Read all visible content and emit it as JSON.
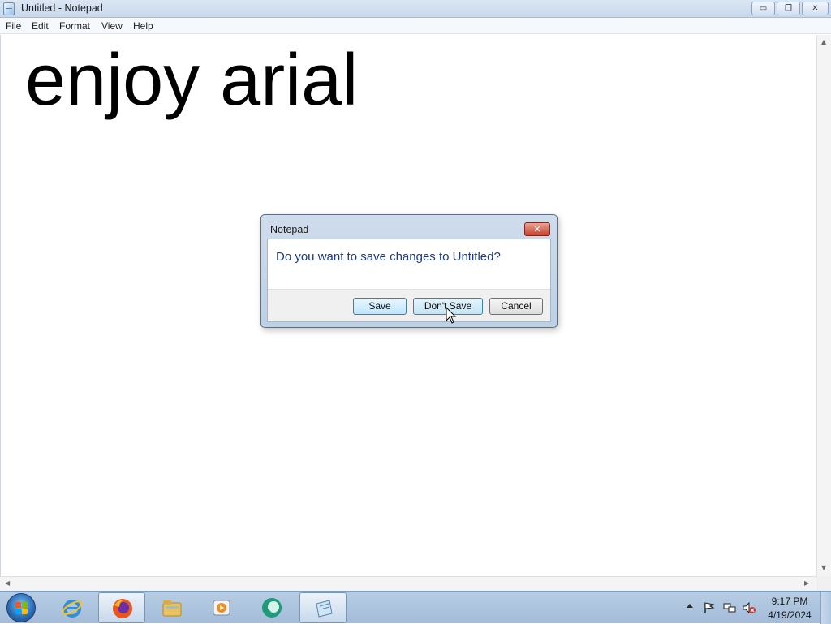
{
  "window": {
    "title": "Untitled - Notepad",
    "controls": {
      "minimize": "▭",
      "maximize": "❐",
      "close": "✕"
    }
  },
  "menu": {
    "items": [
      "File",
      "Edit",
      "Format",
      "View",
      "Help"
    ]
  },
  "editor": {
    "content": "enjoy arial"
  },
  "dialog": {
    "title": "Notepad",
    "close_glyph": "✕",
    "message": "Do you want to save changes to Untitled?",
    "buttons": {
      "save": "Save",
      "dont_save": "Don't Save",
      "cancel": "Cancel"
    }
  },
  "taskbar": {
    "apps": [
      {
        "name": "internet-explorer-icon",
        "active": false
      },
      {
        "name": "firefox-icon",
        "active": true
      },
      {
        "name": "file-explorer-icon",
        "active": false
      },
      {
        "name": "media-player-icon",
        "active": false
      },
      {
        "name": "app-icon",
        "active": false
      },
      {
        "name": "notepad-icon",
        "active": true
      }
    ],
    "clock": {
      "time": "9:17 PM",
      "date": "4/19/2024"
    }
  },
  "colors": {
    "dialog_message": "#1e3a8a",
    "titlebar": "#c9d8ec",
    "taskbar": "#a3bcd9"
  }
}
